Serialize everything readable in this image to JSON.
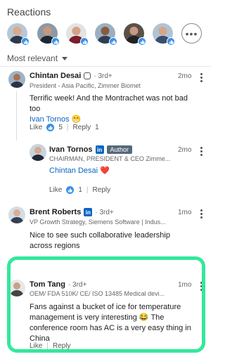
{
  "reactions": {
    "title": "Reactions",
    "more_label": "•••",
    "avatars": [
      "avatar-1",
      "avatar-2",
      "avatar-3",
      "avatar-4",
      "avatar-5",
      "avatar-6"
    ]
  },
  "sort": {
    "label": "Most relevant"
  },
  "comments": [
    {
      "name": "Chintan Desai",
      "degree": "· 3rd+",
      "headline": "President - Asia Pacific, Zimmer Biomet",
      "time": "2mo",
      "text": "Terrific week! And the Montrachet was not bad too",
      "mention": "Ivan Tornos",
      "emoji": "😁",
      "like_label": "Like",
      "like_count": "5",
      "reply_label": "Reply",
      "reply_count": "1"
    },
    {
      "name": "Ivan Tornos",
      "linkedin_badge": "in",
      "author_label": "Author",
      "headline": "CHAIRMAN, PRESIDENT & CEO Zimme...",
      "time": "2mo",
      "mention": "Chintan Desai",
      "emoji": "❤️",
      "like_label": "Like",
      "like_count": "1",
      "reply_label": "Reply"
    },
    {
      "name": "Brent Roberts",
      "linkedin_badge": "in",
      "degree": "· 3rd+",
      "headline": "VP Growth Strategy, Siemens Software | Indus...",
      "time": "1mo",
      "text": "Nice to see such collaborative leadership across regions"
    },
    {
      "name": "Tom Tang",
      "degree": "· 3rd+",
      "headline": "OEM/ FDA 510K/ CE/ ISO 13485 Medical devi...",
      "time": "1mo",
      "text": "Fans against a bucket of ice for temperature management is very interesting 😂 The conference room  has AC is a very easy thing in China",
      "like_label": "Like",
      "reply_label": "Reply"
    }
  ],
  "colors": {
    "accent": "#0a66c2",
    "like_blue": "#378fe9",
    "highlight": "#33e89b"
  }
}
